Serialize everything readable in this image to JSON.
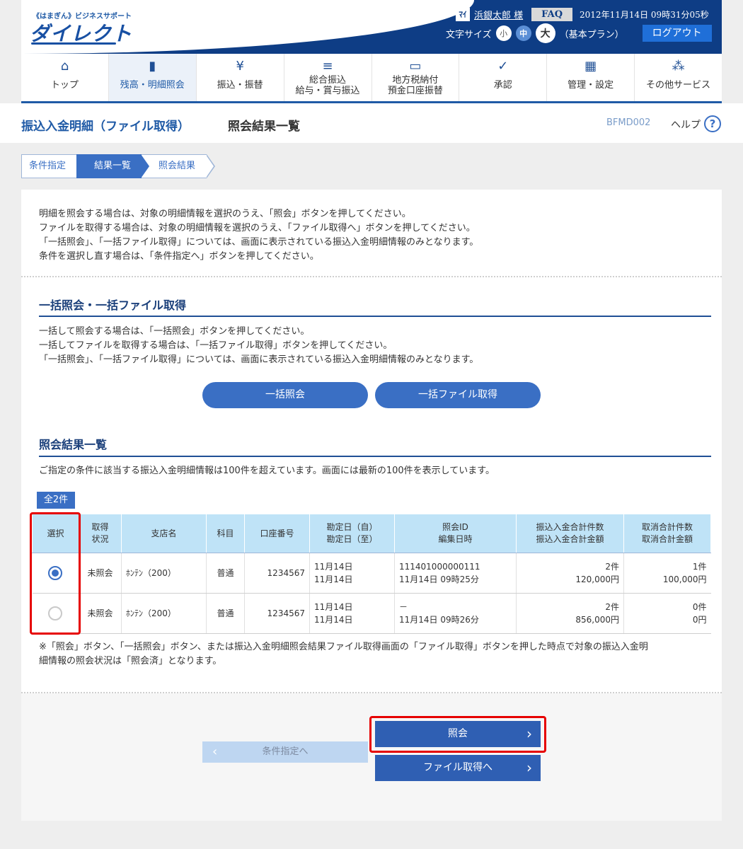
{
  "header": {
    "logo_sub": "《はまぎん》ビジネスサポート",
    "logo_main": "ダイレクト",
    "user_icon": "ﾏｲ",
    "user_name": "浜銀太郎 様",
    "faq": "FAQ",
    "datetime": "2012年11月14日 09時31分05秒",
    "font_size_label": "文字サイズ",
    "size_small": "小",
    "size_mid": "中",
    "size_large": "大",
    "plan": "（基本プラン）",
    "logout": "ログアウト"
  },
  "nav": {
    "items": [
      {
        "icon": "home-icon",
        "glyph": "⌂",
        "label": "トップ"
      },
      {
        "icon": "document-icon",
        "glyph": "▮",
        "label": "残高・明細照会"
      },
      {
        "icon": "yen-transfer-icon",
        "glyph": "¥",
        "label": "振込・振替"
      },
      {
        "icon": "database-icon",
        "glyph": "≡",
        "label1": "総合振込",
        "label2": "給与・賞与振込"
      },
      {
        "icon": "tax-card-icon",
        "glyph": "▭",
        "label1": "地方税納付",
        "label2": "預金口座振替"
      },
      {
        "icon": "approve-icon",
        "glyph": "✓",
        "label": "承認"
      },
      {
        "icon": "admin-icon",
        "glyph": "▦",
        "label": "管理・設定"
      },
      {
        "icon": "services-icon",
        "glyph": "⁂",
        "label": "その他サービス"
      }
    ]
  },
  "page": {
    "title": "振込入金明細（ファイル取得）",
    "subtitle": "照会結果一覧",
    "screen_id": "BFMD002",
    "help": "ヘルプ",
    "help_icon": "?"
  },
  "steps": [
    "条件指定",
    "結果一覧",
    "照会結果"
  ],
  "intro": [
    "明細を照会する場合は、対象の明細情報を選択のうえ、「照会」ボタンを押してください。",
    "ファイルを取得する場合は、対象の明細情報を選択のうえ、「ファイル取得へ」ボタンを押してください。",
    "「一括照会」、「一括ファイル取得」については、画面に表示されている振込入金明細情報のみとなります。",
    "条件を選択し直す場合は、「条件指定へ」ボタンを押してください。"
  ],
  "bulk": {
    "title": "一括照会・一括ファイル取得",
    "lines": [
      "一括して照会する場合は、「一括照会」ボタンを押してください。",
      "一括してファイルを取得する場合は、「一括ファイル取得」ボタンを押してください。",
      "「一括照会」、「一括ファイル取得」については、画面に表示されている振込入金明細情報のみとなります。"
    ],
    "btn_inquiry": "一括照会",
    "btn_file": "一括ファイル取得"
  },
  "results": {
    "title": "照会結果一覧",
    "notice": "ご指定の条件に該当する振込入金明細情報は100件を超えています。画面には最新の100件を表示しています。",
    "count": "全2件",
    "headers": {
      "select": "選択",
      "status1": "取得",
      "status2": "状況",
      "branch": "支店名",
      "subject": "科目",
      "account": "口座番号",
      "date1": "勘定日（自）",
      "date2": "勘定日（至）",
      "id1": "照会ID",
      "id2": "編集日時",
      "in1": "振込入金合計件数",
      "in2": "振込入金合計金額",
      "cancel1": "取消合計件数",
      "cancel2": "取消合計金額"
    },
    "rows": [
      {
        "selected": true,
        "status": "未照会",
        "branch": "ﾎﾝﾃﾝ（200）",
        "subject": "普通",
        "account": "1234567",
        "date_from": "11月14日",
        "date_to": "11月14日",
        "inquiry_id": "111401000000111",
        "edited": "11月14日 09時25分",
        "in_count": "2件",
        "in_amount": "120,000円",
        "cancel_count": "1件",
        "cancel_amount": "100,000円"
      },
      {
        "selected": false,
        "status": "未照会",
        "branch": "ﾎﾝﾃﾝ（200）",
        "subject": "普通",
        "account": "1234567",
        "date_from": "11月14日",
        "date_to": "11月14日",
        "inquiry_id": "－",
        "edited": "11月14日 09時26分",
        "in_count": "2件",
        "in_amount": "856,000円",
        "cancel_count": "0件",
        "cancel_amount": "0円"
      }
    ],
    "note1": "※「照会」ボタン、「一括照会」ボタン、または振込入金明細照会結果ファイル取得画面の「ファイル取得」ボタンを押した時点で対象の振込入金明",
    "note2": "細情報の照会状況は「照会済」となります。"
  },
  "footer": {
    "back": "条件指定へ",
    "inquiry": "照会",
    "file": "ファイル取得へ",
    "chev_left": "‹",
    "chev_right": "›"
  },
  "colors": {
    "brand": "#0e3d85",
    "accent": "#3a6fc4",
    "highlight": "#e60000"
  }
}
